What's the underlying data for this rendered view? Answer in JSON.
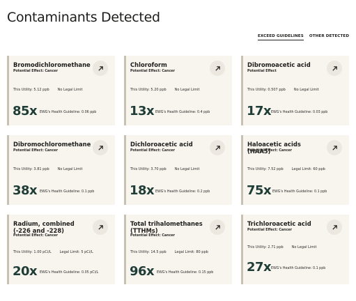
{
  "page": {
    "title": "Contaminants Detected"
  },
  "tabs": [
    {
      "label": "EXCEED GUIDELINES",
      "active": true
    },
    {
      "label": "OTHER DETECTED",
      "active": false
    }
  ],
  "accent_color": "#1f3d36",
  "icons": {
    "open": "arrow-up-right-icon"
  },
  "cards": [
    {
      "name": "Bromodichloromethane",
      "effect": "Potential Effect: Cancer",
      "utility": "This Utility: 5.12 ppb",
      "legal": "No Legal Limit",
      "multiplier": "85x",
      "guideline": "EWG's Health Guideline: 0.06 ppb"
    },
    {
      "name": "Chloroform",
      "effect": "Potential Effect: Cancer",
      "utility": "This Utility: 5.20 ppb",
      "legal": "No Legal Limit",
      "multiplier": "13x",
      "guideline": "EWG's Health Guideline: 0.4 ppb"
    },
    {
      "name": "Dibromoacetic acid",
      "effect": "Potential Effect",
      "utility": "This Utility: 0.507 ppb",
      "legal": "No Legal Limit",
      "multiplier": "17x",
      "guideline": "EWG's Health Guideline: 0.03 ppb"
    },
    {
      "name": "Dibromochloromethane",
      "effect": "Potential Effect: Cancer",
      "utility": "This Utility: 3.81 ppb",
      "legal": "No Legal Limit",
      "multiplier": "38x",
      "guideline": "EWG's Health Guideline: 0.1 ppb"
    },
    {
      "name": "Dichloroacetic acid",
      "effect": "Potential Effect: Cancer",
      "utility": "This Utility: 3.70 ppb",
      "legal": "No Legal Limit",
      "multiplier": "18x",
      "guideline": "EWG's Health Guideline: 0.2 ppb"
    },
    {
      "name": "Haloacetic acids (HAA5)",
      "effect": "Potential Effect: Cancer",
      "utility": "This Utility: 7.52 ppb",
      "legal": "Legal Limit: 60 ppb",
      "multiplier": "75x",
      "guideline": "EWG's Health Guideline: 0.1 ppb"
    },
    {
      "name": "Radium, combined (-226 and -228)",
      "effect": "Potential Effect: Cancer",
      "utility": "This Utility: 1.00 pCi/L",
      "legal": "Legal Limit: 5 pCi/L",
      "multiplier": "20x",
      "guideline": "EWG's Health Guideline: 0.05 pCi/L"
    },
    {
      "name": "Total trihalomethanes (TTHMs)",
      "effect": "Potential Effect: Cancer",
      "utility": "This Utility: 14.5 ppb",
      "legal": "Legal Limit: 80 ppb",
      "multiplier": "96x",
      "guideline": "EWG's Health Guideline: 0.15 ppb"
    },
    {
      "name": "Trichloroacetic acid",
      "effect": "Potential Effect: Cancer",
      "utility": "This Utility: 2.71 ppb",
      "legal": "No Legal Limit",
      "multiplier": "27x",
      "guideline": "EWG's Health Guideline: 0.1 ppb"
    }
  ]
}
